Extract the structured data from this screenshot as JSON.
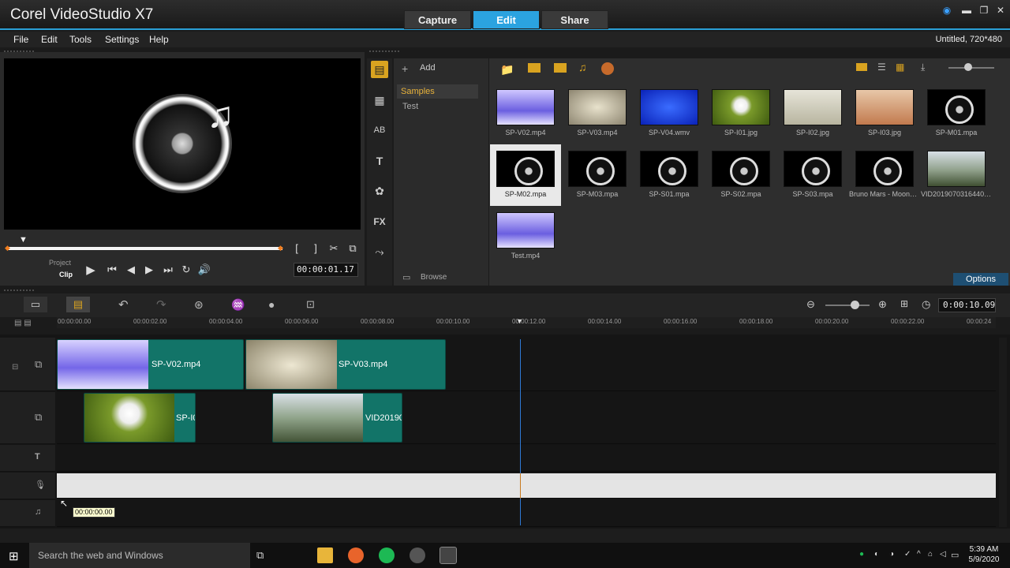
{
  "app": {
    "title": "Corel VideoStudio X7",
    "project_info": "Untitled, 720*480"
  },
  "mode_tabs": [
    {
      "label": "Capture"
    },
    {
      "label": "Edit"
    },
    {
      "label": "Share"
    }
  ],
  "menu": [
    {
      "label": "File"
    },
    {
      "label": "Edit"
    },
    {
      "label": "Tools"
    },
    {
      "label": "Settings"
    },
    {
      "label": "Help"
    }
  ],
  "player": {
    "project_label": "Project",
    "clip_label": "Clip",
    "timecode": "00:00:01.17"
  },
  "library": {
    "add_label": "Add",
    "folders": [
      {
        "label": "Samples"
      },
      {
        "label": "Test"
      }
    ],
    "browse_label": "Browse",
    "options_label": "Options",
    "items": [
      {
        "name": "SP-V02.mp4"
      },
      {
        "name": "SP-V03.mp4"
      },
      {
        "name": "SP-V04.wmv"
      },
      {
        "name": "SP-I01.jpg"
      },
      {
        "name": "SP-I02.jpg"
      },
      {
        "name": "SP-I03.jpg"
      },
      {
        "name": "SP-M01.mpa"
      },
      {
        "name": "SP-M02.mpa"
      },
      {
        "name": "SP-M03.mpa"
      },
      {
        "name": "SP-S01.mpa"
      },
      {
        "name": "SP-S02.mpa"
      },
      {
        "name": "SP-S03.mpa"
      },
      {
        "name": "Bruno Mars - Moonsh..."
      },
      {
        "name": "VID20190703164402..."
      },
      {
        "name": "Test.mp4"
      }
    ]
  },
  "timeline": {
    "duration": "0:00:10.09",
    "ruler_ticks": [
      "00:00:00.00",
      "00:00:02.00",
      "00:00:04.00",
      "00:00:06.00",
      "00:00:08.00",
      "00:00:10.00",
      "00:00:12.00",
      "00:00:14.00",
      "00:00:16.00",
      "00:00:18.00",
      "00:00:20.00",
      "00:00:22.00",
      "00:00:24"
    ],
    "video_clips": [
      {
        "name": "SP-V02.mp4"
      },
      {
        "name": "SP-V03.mp4"
      }
    ],
    "overlay_clips": [
      {
        "name": "SP-I0"
      },
      {
        "name": "VID20190"
      }
    ],
    "cursor_time": "00:00:00.00"
  },
  "taskbar": {
    "search_placeholder": "Search the web and Windows",
    "time": "5:39 AM",
    "date": "5/9/2020"
  },
  "colors": {
    "accent": "#2ba3e0",
    "clip": "#127468",
    "library_selected": "#d9a320"
  }
}
